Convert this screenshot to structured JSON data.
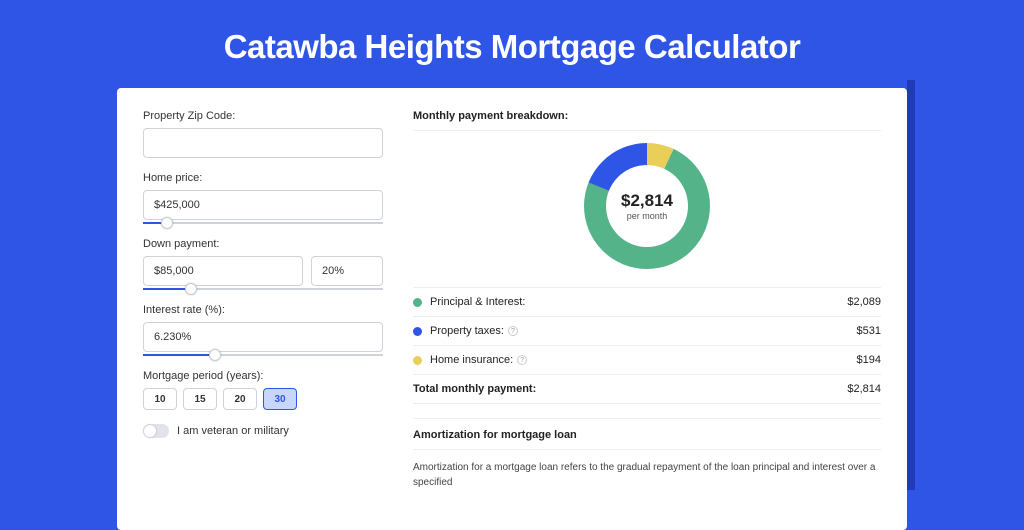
{
  "title": "Catawba Heights Mortgage Calculator",
  "form": {
    "zip_label": "Property Zip Code:",
    "zip_value": "",
    "home_price_label": "Home price:",
    "home_price_value": "$425,000",
    "home_price_slider_pct": 10,
    "down_payment_label": "Down payment:",
    "down_payment_value": "$85,000",
    "down_payment_pct": "20%",
    "down_payment_slider_pct": 20,
    "rate_label": "Interest rate (%):",
    "rate_value": "6.230%",
    "rate_slider_pct": 30,
    "period_label": "Mortgage period (years):",
    "periods": [
      "10",
      "15",
      "20",
      "30"
    ],
    "period_active_index": 3,
    "veteran_label": "I am veteran or military",
    "veteran_checked": false
  },
  "breakdown": {
    "heading": "Monthly payment breakdown:",
    "center_amount": "$2,814",
    "center_sub": "per month",
    "items": [
      {
        "label": "Principal & Interest:",
        "value": "$2,089",
        "color": "green",
        "help": false
      },
      {
        "label": "Property taxes:",
        "value": "$531",
        "color": "blue",
        "help": true
      },
      {
        "label": "Home insurance:",
        "value": "$194",
        "color": "yellow",
        "help": true
      }
    ],
    "total_label": "Total monthly payment:",
    "total_value": "$2,814"
  },
  "amortization": {
    "heading": "Amortization for mortgage loan",
    "body": "Amortization for a mortgage loan refers to the gradual repayment of the loan principal and interest over a specified"
  },
  "chart_data": {
    "type": "pie",
    "title": "Monthly payment breakdown",
    "series": [
      {
        "name": "Principal & Interest",
        "value": 2089,
        "color": "#55b38a"
      },
      {
        "name": "Property taxes",
        "value": 531,
        "color": "#2f55e6"
      },
      {
        "name": "Home insurance",
        "value": 194,
        "color": "#e9cf5a"
      }
    ],
    "total": 2814,
    "center_label": "$2,814 per month"
  }
}
